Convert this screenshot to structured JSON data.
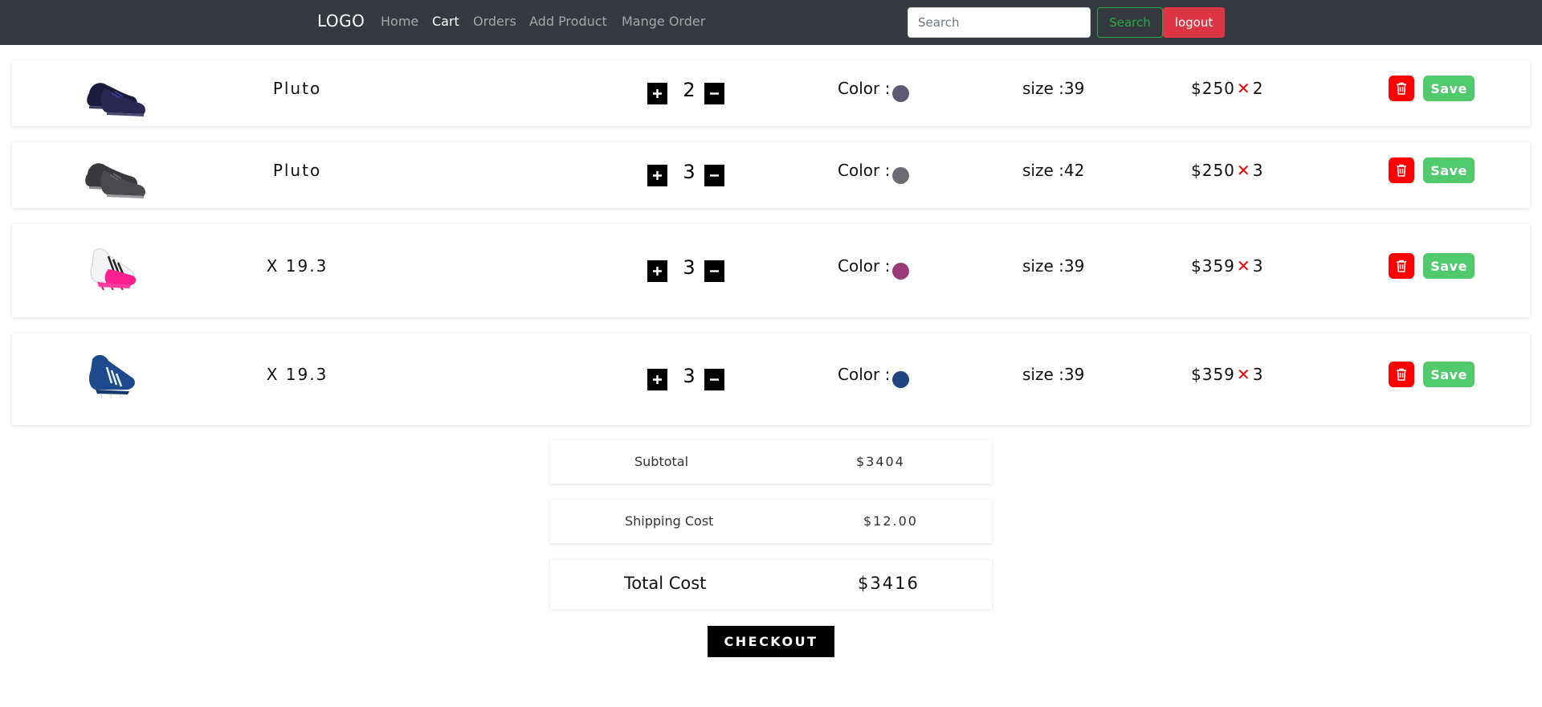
{
  "nav": {
    "logo": "LOGO",
    "links": [
      "Home",
      "Cart",
      "Orders",
      "Add Product",
      "Mange Order"
    ],
    "active": "Cart",
    "search_placeholder": "Search",
    "search_button": "Search",
    "logout_button": "logout"
  },
  "cart": {
    "color_label": "Color :",
    "size_label": "size :",
    "save_label": "Save",
    "currency": "$",
    "times_symbol": "✕",
    "items": [
      {
        "name": "Pluto",
        "quantity": "2",
        "color": "#5b5a72",
        "size": "39",
        "price": "250",
        "price_qty": "2",
        "image_icon": "navy-sneaker"
      },
      {
        "name": "Pluto",
        "quantity": "3",
        "color": "#6b6b72",
        "size": "42",
        "price": "250",
        "price_qty": "3",
        "image_icon": "grey-sneaker"
      },
      {
        "name": "X 19.3",
        "quantity": "3",
        "color": "#9b3a78",
        "size": "39",
        "price": "359",
        "price_qty": "3",
        "image_icon": "pink-football-boot"
      },
      {
        "name": "X 19.3",
        "quantity": "3",
        "color": "#1f4680",
        "size": "39",
        "price": "359",
        "price_qty": "3",
        "image_icon": "blue-football-boot"
      }
    ]
  },
  "summary": {
    "subtotal_label": "Subtotal",
    "subtotal_value": "$3404",
    "shipping_label": "Shipping Cost",
    "shipping_value": "$12.00",
    "total_label": "Total Cost",
    "total_value": "$3416"
  },
  "checkout_label": "CHECKOUT"
}
